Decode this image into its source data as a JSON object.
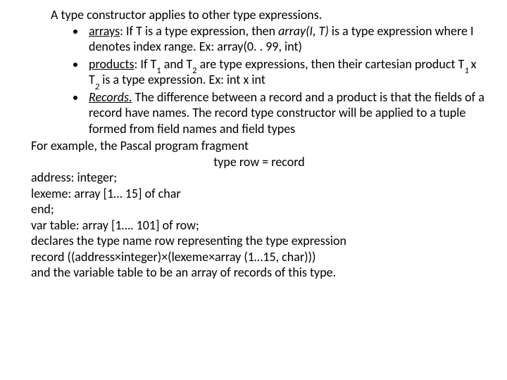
{
  "intro": "A type constructor applies to other type expressions.",
  "bullets": {
    "arrays": {
      "label": "arrays",
      "colon": ": If T is a type expression, then ",
      "func": "array(I, T)",
      "tail": " is a type expression where I denotes index range. Ex: array(0. . 99, int)"
    },
    "products": {
      "label": "products",
      "colon": ": If T",
      "and": " and T",
      "mid": "  are type expressions, then their cartesian product T",
      "x": " x T",
      "end": "  is a type expression.  Ex: int x int"
    },
    "records": {
      "label": "Records.",
      "text": " The difference between a record and a product is that the fields of a record have names. The record type constructor will be applied to a tuple formed from field names and field types"
    }
  },
  "example": {
    "l1": "For example, the Pascal program fragment",
    "l2": "type row = record",
    "l3": "address: integer;",
    "l4": "lexeme: array  [1… 15] of char",
    "l5": "end;",
    "l6": "var   table:  array [1…. 101] of row;",
    "l7": "declares the type name row representing the type expression",
    "l8": "record ((address×integer)×(lexeme×array (1…15, char)))",
    "l9": "and the variable table to be an array of records of this type."
  }
}
